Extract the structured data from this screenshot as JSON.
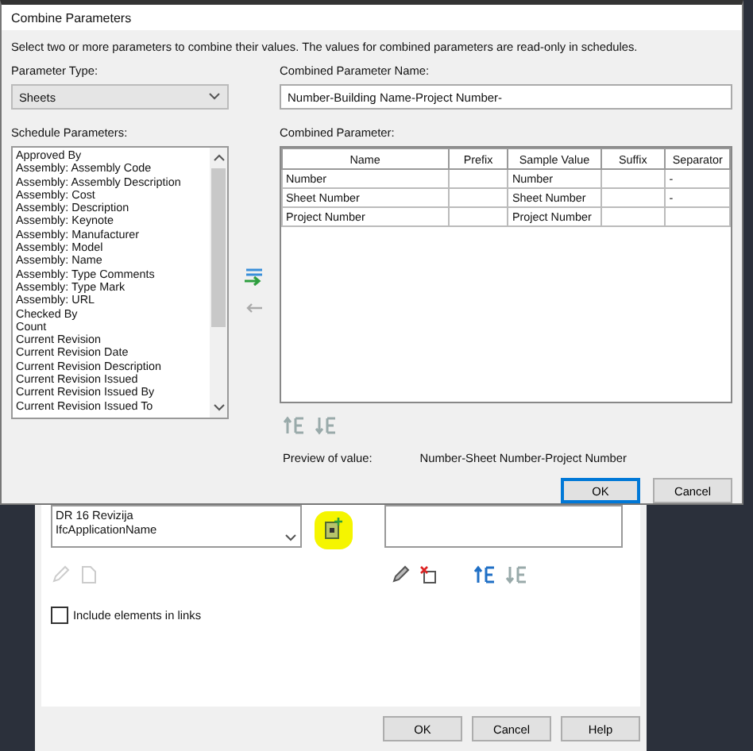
{
  "dialog": {
    "title": "Combine Parameters",
    "instructions": "Select two or more parameters to combine their values.  The values for combined parameters are read-only in schedules.",
    "parameter_type": {
      "label": "Parameter Type:",
      "value": "Sheets"
    },
    "schedule_parameters": {
      "label": "Schedule Parameters:",
      "items": [
        "Approved By",
        "Assembly: Assembly Code",
        "Assembly: Assembly Description",
        "Assembly: Cost",
        "Assembly: Description",
        "Assembly: Keynote",
        "Assembly: Manufacturer",
        "Assembly: Model",
        "Assembly: Name",
        "Assembly: Type Comments",
        "Assembly: Type Mark",
        "Assembly: URL",
        "Checked By",
        "Count",
        "Current Revision",
        "Current Revision Date",
        "Current Revision Description",
        "Current Revision Issued",
        "Current Revision Issued By",
        "Current Revision Issued To"
      ]
    },
    "combined_name": {
      "label": "Combined Parameter Name:",
      "value": "Number-Building Name-Project Number-"
    },
    "combined_parameter": {
      "label": "Combined Parameter:",
      "columns": [
        "Name",
        "Prefix",
        "Sample Value",
        "Suffix",
        "Separator"
      ],
      "rows": [
        {
          "name": "Number",
          "sample_value": "Number",
          "separator": "-"
        },
        {
          "name": "Sheet Number",
          "sample_value": "Sheet Number",
          "separator": "-"
        },
        {
          "name": "Project Number",
          "sample_value": "Project Number"
        }
      ]
    },
    "preview": {
      "label": "Preview of value:",
      "value": "Number-Sheet Number-Project Number"
    },
    "buttons": [
      {
        "label": "OK",
        "default": true
      },
      {
        "label": "Cancel",
        "default": false
      }
    ]
  },
  "background_dialog": {
    "list_items": [
      "DR 16 Revizija",
      "IfcApplicationName"
    ],
    "checkbox": {
      "label": "Include elements in links",
      "checked": false
    },
    "buttons": [
      "OK",
      "Cancel",
      "Help"
    ]
  }
}
